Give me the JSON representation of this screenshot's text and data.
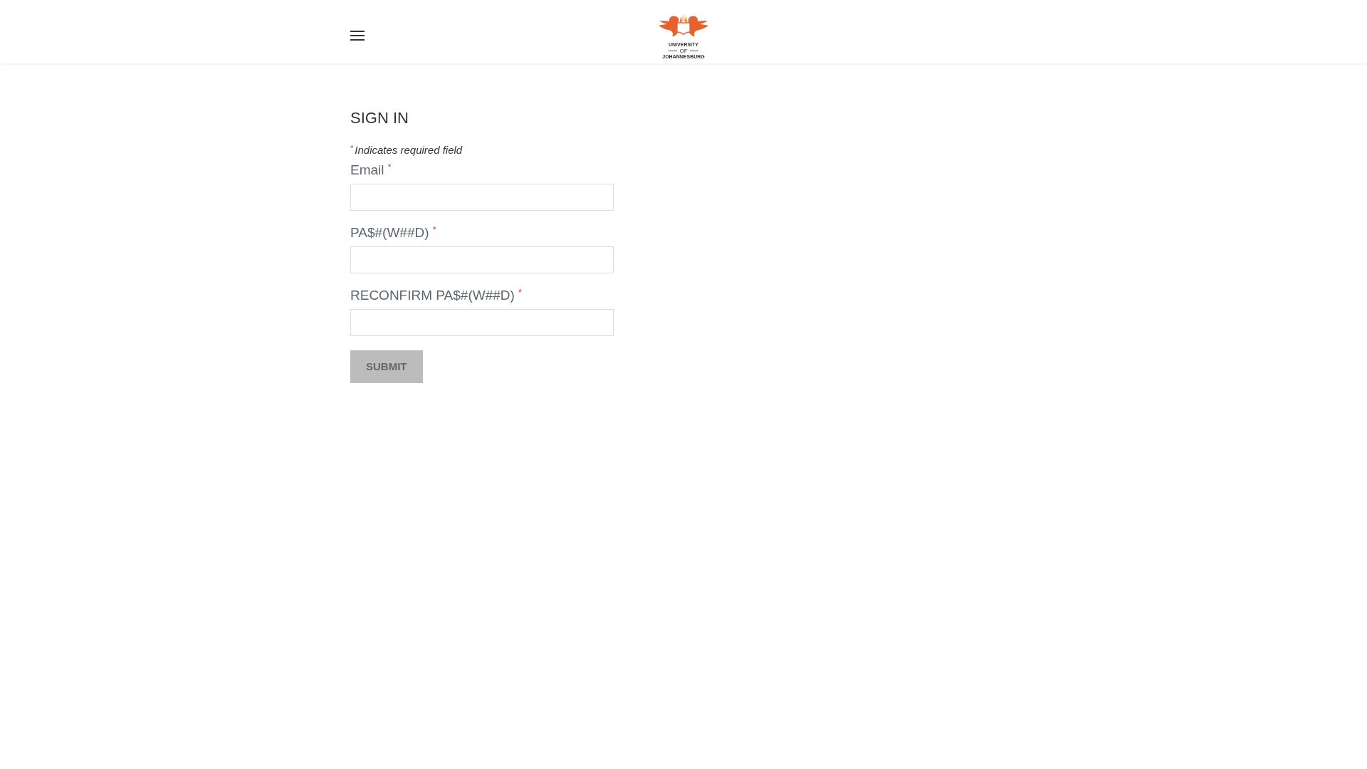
{
  "header": {
    "logo": {
      "lines": [
        {
          "kind": "main",
          "text": "UNIVERSITY"
        },
        {
          "kind": "small",
          "text": "OF"
        },
        {
          "kind": "main",
          "text": "JOHANNESBURG"
        }
      ]
    }
  },
  "form": {
    "title": "SIGN IN",
    "note": {
      "mark": "*",
      "text": "Indicates required field"
    },
    "fields": [
      {
        "label": "Email",
        "required_mark": "*"
      },
      {
        "label": "PA$#(W##D)",
        "required_mark": "*"
      },
      {
        "label": "RECONFIRM PA$#(W##D)",
        "required_mark": "*"
      }
    ],
    "submit": {
      "label": "SUBMIT"
    }
  }
}
